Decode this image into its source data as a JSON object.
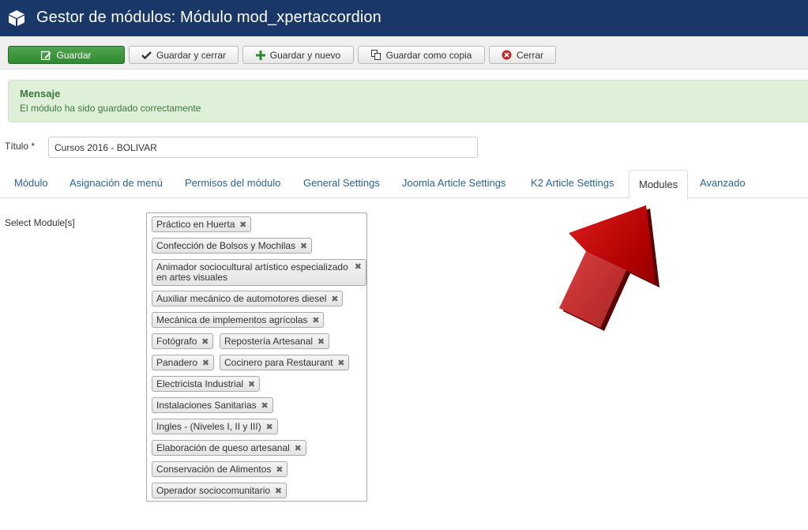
{
  "header": {
    "title": "Gestor de módulos: Módulo mod_xpertaccordion"
  },
  "toolbar": {
    "save": "Guardar",
    "save_close": "Guardar y cerrar",
    "save_new": "Guardar y nuevo",
    "save_copy": "Guardar como copia",
    "close": "Cerrar"
  },
  "alert": {
    "heading": "Mensaje",
    "text": "El módulo ha sido guardado correctamente"
  },
  "form": {
    "title_label": "Título *",
    "title_value": "Cursos 2016 - BOLIVAR",
    "select_label": "Select Module[s]"
  },
  "tabs": [
    "Módulo",
    "Asignación de menú",
    "Permisos del módulo",
    "General Settings",
    "Joomla Article Settings",
    "K2 Article Settings",
    "Modules",
    "Avanzado"
  ],
  "active_tab": "Modules",
  "modules": [
    "Práctico en Huerta",
    "Confección de Bolsos y Mochilas",
    "Animador sociocultural artístico especializado en artes visuales",
    "Auxiliar mecánico de automotores diesel",
    "Mecánica de implementos agrícolas",
    "Fotógrafo",
    "Repostería Artesanal",
    "Panadero",
    "Cocinero para Restaurant",
    "Electricista Industrial",
    "Instalaciones Sanitarias",
    "Ingles - (Niveles I, II y III)",
    "Elaboración de queso artesanal",
    "Conservación de Alimentos",
    "Operador sociocomunitario"
  ],
  "colors": {
    "header_bg": "#1a3867",
    "save_button": "#3e963e",
    "alert_bg": "#dff0d8",
    "arrow": "#c00000"
  },
  "icons": {
    "header": "cube-icon",
    "save": "edit-icon",
    "save_close": "check-icon",
    "save_new": "plus-icon",
    "save_copy": "copy-icon",
    "close": "cancel-circle-icon",
    "chip_remove": "remove-x-icon",
    "annotation": "red-arrow-icon"
  }
}
